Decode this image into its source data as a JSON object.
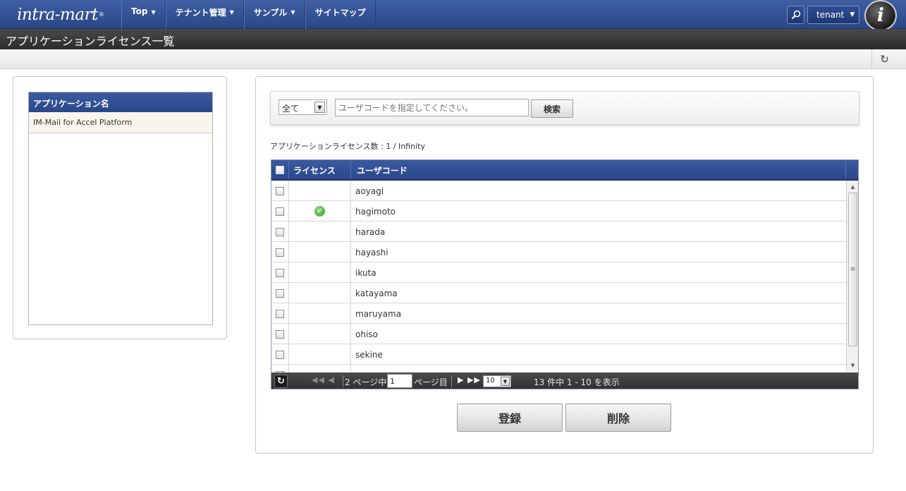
{
  "brand": {
    "logo_text": "intra-mart",
    "logo_mark": "®",
    "badge_letter": "i"
  },
  "nav": {
    "items": [
      {
        "label": "Top",
        "has_caret": true
      },
      {
        "label": "テナント管理",
        "has_caret": true
      },
      {
        "label": "サンプル",
        "has_caret": true
      },
      {
        "label": "サイトマップ",
        "has_caret": false
      }
    ],
    "tenant_label": "tenant"
  },
  "page": {
    "title": "アプリケーションライセンス一覧"
  },
  "app_list": {
    "header": "アプリケーション名",
    "items": [
      "IM-Mail for Accel Platform"
    ]
  },
  "filter": {
    "select_value": "全て",
    "input_placeholder": "ユーザコードを指定してください。",
    "search_label": "検索"
  },
  "license_count": "アプリケーションライセンス数 : 1 / Infinity",
  "grid": {
    "columns": [
      "ライセンス",
      "ユーザコード"
    ],
    "rows": [
      {
        "licensed": false,
        "user": "aoyagi"
      },
      {
        "licensed": true,
        "user": "hagimoto"
      },
      {
        "licensed": false,
        "user": "harada"
      },
      {
        "licensed": false,
        "user": "hayashi"
      },
      {
        "licensed": false,
        "user": "ikuta"
      },
      {
        "licensed": false,
        "user": "katayama"
      },
      {
        "licensed": false,
        "user": "maruyama"
      },
      {
        "licensed": false,
        "user": "ohiso"
      },
      {
        "licensed": false,
        "user": "sekine"
      },
      {
        "licensed": false,
        "user": ""
      }
    ]
  },
  "pager": {
    "total_pages_text": "2 ページ中",
    "page_value": "1",
    "page_suffix": "ページ目",
    "rows_per_page": "10",
    "range_text": "13 件中 1 - 10 を表示"
  },
  "actions": {
    "register_label": "登録",
    "delete_label": "削除"
  },
  "colors": {
    "nav_blue": "#2b4787",
    "title_dark": "#2b2b2b",
    "licensed_green": "#2e9b2a"
  }
}
